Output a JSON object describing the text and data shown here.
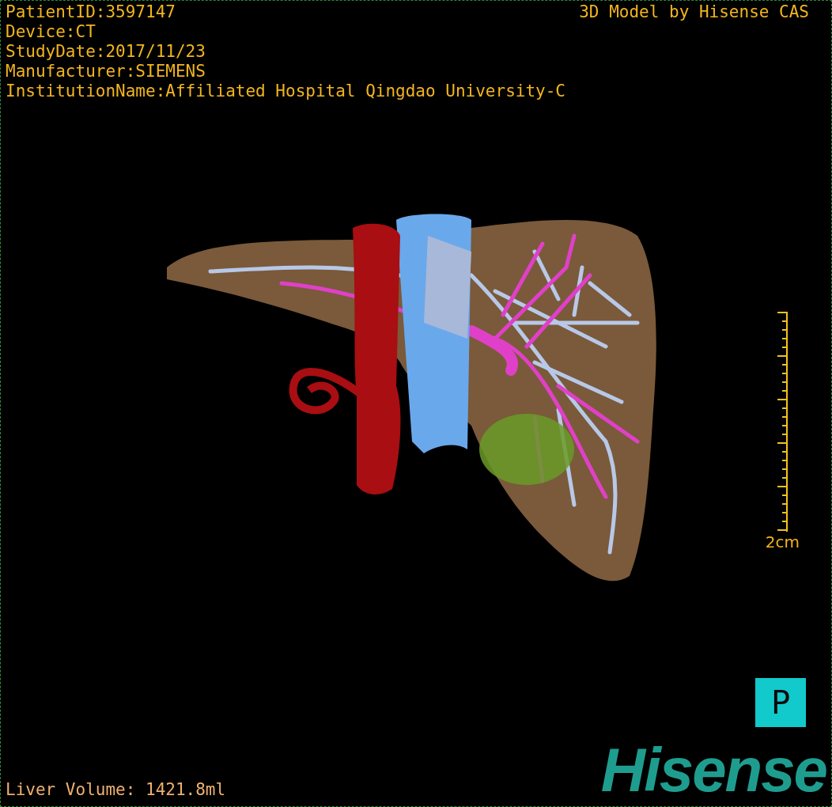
{
  "patient_info": [
    "PatientID:3597147",
    "Device:CT",
    "StudyDate:2017/11/23",
    "Manufacturer:SIEMENS",
    "InstitutionName:Affiliated Hospital Qingdao University-C"
  ],
  "model_title": "3D Model by Hisense CAS",
  "scale_bar": {
    "label": "2cm"
  },
  "orientation_marker": "P",
  "liver_volume": "Liver Volume: 1421.8ml",
  "logo": "Hisense"
}
